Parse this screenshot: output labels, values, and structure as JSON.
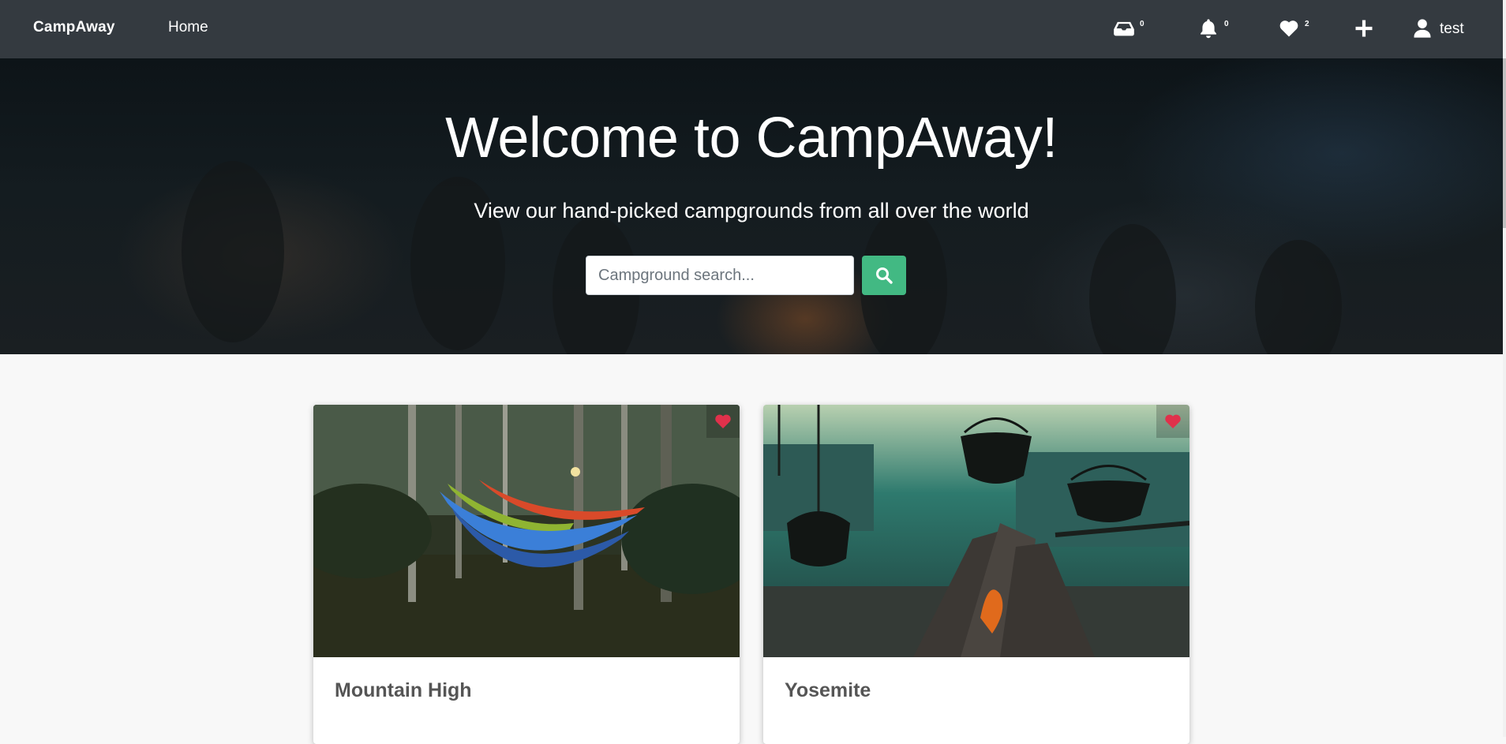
{
  "navbar": {
    "brand": "CampAway",
    "home_label": "Home",
    "inbox_count": "0",
    "notifications_count": "0",
    "favorites_count": "2",
    "username": "test"
  },
  "hero": {
    "title": "Welcome to CampAway!",
    "subtitle": "View our hand-picked campgrounds from all over the world",
    "search_placeholder": "Campground search..."
  },
  "campgrounds": [
    {
      "name": "Mountain High",
      "favorited": true
    },
    {
      "name": "Yosemite",
      "favorited": true
    }
  ],
  "colors": {
    "navbar": "#343a40",
    "search_button": "#42b983",
    "favorite_heart": "#e0314b"
  }
}
